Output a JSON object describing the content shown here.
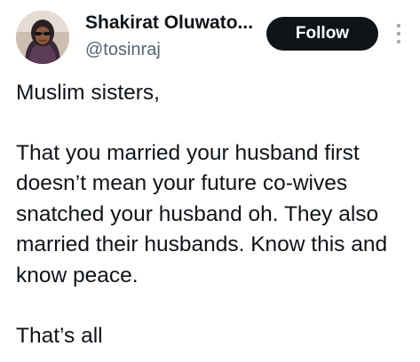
{
  "user": {
    "display_name": "Shakirat Oluwato...",
    "handle": "@tosinraj",
    "avatar_icon": "profile-photo"
  },
  "actions": {
    "follow_label": "Follow",
    "more_icon": "vertical-ellipsis-icon"
  },
  "tweet": {
    "paragraphs": [
      "Muslim sisters,",
      "That you married your husband first doesn’t mean your future co-wives snatched your husband oh. They also married their husbands. Know this and know peace.",
      "That’s all"
    ]
  },
  "colors": {
    "text": "#0f1419",
    "secondary_text": "#536471",
    "follow_button_bg": "#0f1419",
    "follow_button_text": "#ffffff"
  }
}
